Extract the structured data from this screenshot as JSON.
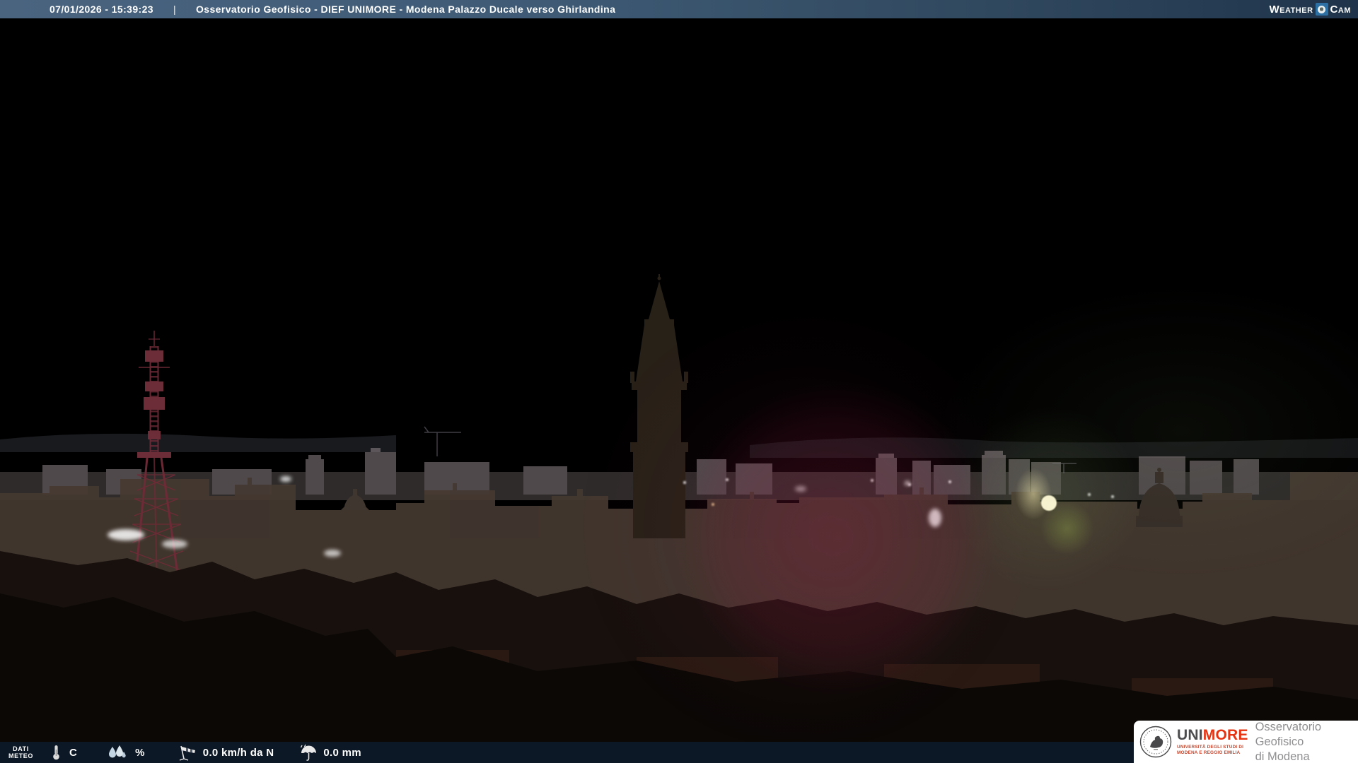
{
  "top_bar": {
    "datetime": "07/01/2026 - 15:39:23",
    "separator": "|",
    "title": "Osservatorio Geofisico - DIEF UNIMORE - Modena Palazzo Ducale verso Ghirlandina",
    "brand": {
      "weather": "Weather",
      "cam": "Cam"
    }
  },
  "bottom_bar": {
    "label": {
      "line1": "DATI",
      "line2": "METEO"
    },
    "temperature": {
      "value": "",
      "unit": "C",
      "icon": "thermometer-icon"
    },
    "humidity": {
      "value": "",
      "unit": "%",
      "icon": "water-drops-icon"
    },
    "wind": {
      "value": "0.0 km/h da N",
      "icon": "windsock-icon"
    },
    "rain": {
      "value": "0.0 mm",
      "icon": "rain-umbrella-icon"
    }
  },
  "logo_box": {
    "unimore": {
      "uni": "UNI",
      "more": "MORE"
    },
    "university": {
      "line1": "UNIVERSITÀ DEGLI STUDI DI",
      "line2": "MODENA E REGGIO EMILIA"
    },
    "observatory": {
      "line1": "Osservatorio Geofisico",
      "line2": "di Modena"
    }
  },
  "colors": {
    "top_bar_left": "#4a6480",
    "top_bar_right": "#1f344a",
    "cam_badge_blue": "#2d71a4",
    "unimore_red": "#e63312",
    "university_red": "#c44a33",
    "observatory_gray": "#8f8f92",
    "bottom_bar_overlay": "rgba(14,30,48,0.78)"
  }
}
